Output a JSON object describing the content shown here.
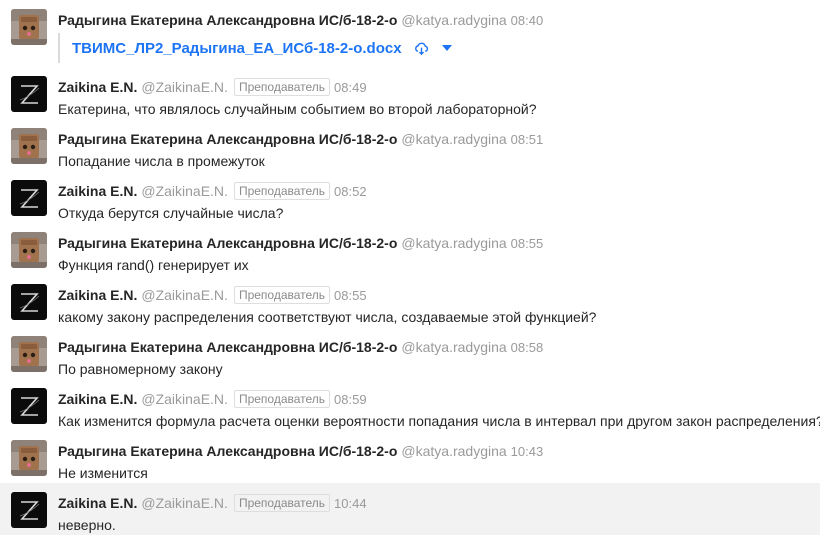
{
  "colors": {
    "link": "#1d74f5",
    "hover_row": "#f2f2f2"
  },
  "messages": [
    {
      "author": "Радыгина Екатерина Александровна ИС/б-18-2-о",
      "username": "@katya.radygina",
      "time": "08:40",
      "avatar": "student",
      "attachment": {
        "name": "ТВИМС_ЛР2_Радыгина_ЕА_ИСб-18-2-о.docx",
        "download_icon": "cloud-download-icon",
        "menu_icon": "caret-down-icon"
      }
    },
    {
      "author": "Zaikina E.N.",
      "username": "@ZaikinaE.N.",
      "badge": "Преподаватель",
      "time": "08:49",
      "avatar": "teacher",
      "text": "Екатерина, что являлось случайным событием во второй лабораторной?"
    },
    {
      "author": "Радыгина Екатерина Александровна ИС/б-18-2-о",
      "username": "@katya.radygina",
      "time": "08:51",
      "avatar": "student",
      "text": "Попадание числа в промежуток"
    },
    {
      "author": "Zaikina E.N.",
      "username": "@ZaikinaE.N.",
      "badge": "Преподаватель",
      "time": "08:52",
      "avatar": "teacher",
      "text": "Откуда берутся случайные числа?"
    },
    {
      "author": "Радыгина Екатерина Александровна ИС/б-18-2-о",
      "username": "@katya.radygina",
      "time": "08:55",
      "avatar": "student",
      "text": "Функция rand() генерирует их"
    },
    {
      "author": "Zaikina E.N.",
      "username": "@ZaikinaE.N.",
      "badge": "Преподаватель",
      "time": "08:55",
      "avatar": "teacher",
      "text": "какому закону распределения соответствуют числа, создаваемые этой функцией?"
    },
    {
      "author": "Радыгина Екатерина Александровна ИС/б-18-2-о",
      "username": "@katya.radygina",
      "time": "08:58",
      "avatar": "student",
      "text": "По равномерному закону"
    },
    {
      "author": "Zaikina E.N.",
      "username": "@ZaikinaE.N.",
      "badge": "Преподаватель",
      "time": "08:59",
      "avatar": "teacher",
      "text": "Как изменится формула расчета оценки вероятности попадания числа в интервал при другом закон распределения?"
    },
    {
      "author": "Радыгина Екатерина Александровна ИС/б-18-2-о",
      "username": "@katya.radygina",
      "time": "10:43",
      "avatar": "student",
      "text": "Не изменится"
    },
    {
      "author": "Zaikina E.N.",
      "username": "@ZaikinaE.N.",
      "badge": "Преподаватель",
      "time": "10:44",
      "avatar": "teacher",
      "text": "неверно.",
      "highlighted": true
    }
  ]
}
